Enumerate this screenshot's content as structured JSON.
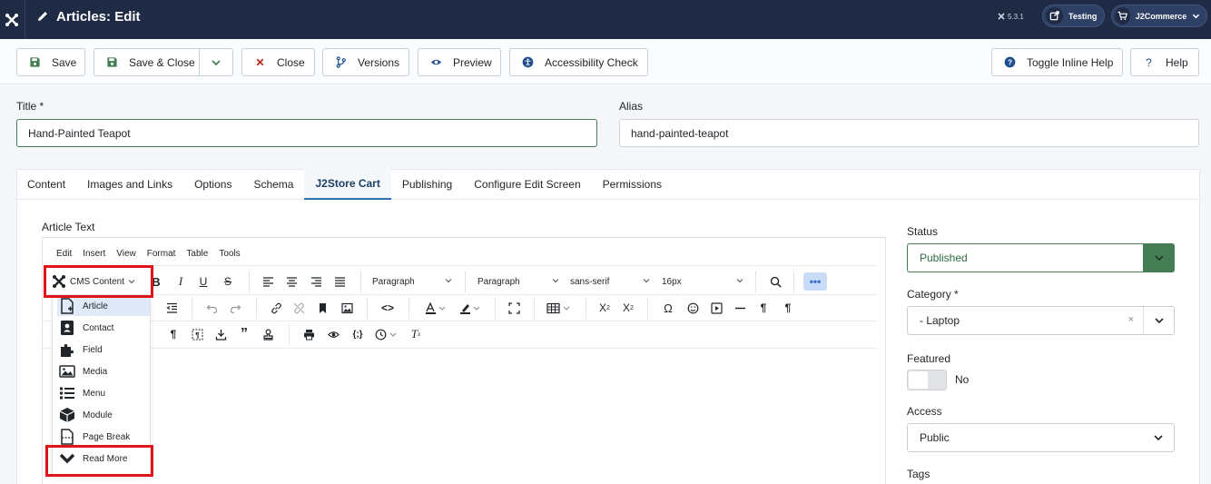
{
  "header": {
    "title": "Articles: Edit",
    "version": "5.3.1",
    "site_pill": "Testing",
    "user_pill": "J2Commerce"
  },
  "toolbar": {
    "save": "Save",
    "save_close": "Save & Close",
    "close": "Close",
    "versions": "Versions",
    "preview": "Preview",
    "accessibility": "Accessibility Check",
    "inline_help": "Toggle Inline Help",
    "help": "Help"
  },
  "form": {
    "title_label": "Title *",
    "title_value": "Hand-Painted Teapot",
    "alias_label": "Alias",
    "alias_value": "hand-painted-teapot"
  },
  "tabs": [
    "Content",
    "Images and Links",
    "Options",
    "Schema",
    "J2Store Cart",
    "Publishing",
    "Configure Edit Screen",
    "Permissions"
  ],
  "editor": {
    "label": "Article Text",
    "menu": [
      "Edit",
      "Insert",
      "View",
      "Format",
      "Table",
      "Tools"
    ],
    "cms_button": "CMS Content",
    "block_format": "Paragraph",
    "style_format": "Paragraph",
    "font_family": "sans-serif",
    "font_size": "16px"
  },
  "dropdown": {
    "items": [
      "Article",
      "Contact",
      "Field",
      "Media",
      "Menu",
      "Module",
      "Page Break",
      "Read More"
    ]
  },
  "sidebar": {
    "status_label": "Status",
    "status_value": "Published",
    "category_label": "Category *",
    "category_value": "- Laptop",
    "featured_label": "Featured",
    "featured_value": "No",
    "access_label": "Access",
    "access_value": "Public",
    "tags_label": "Tags"
  },
  "colors": {
    "header_bg": "#1f2b45",
    "status_green": "#457d54",
    "highlight_red": "#e0141b",
    "active_tab": "#3071a9"
  }
}
